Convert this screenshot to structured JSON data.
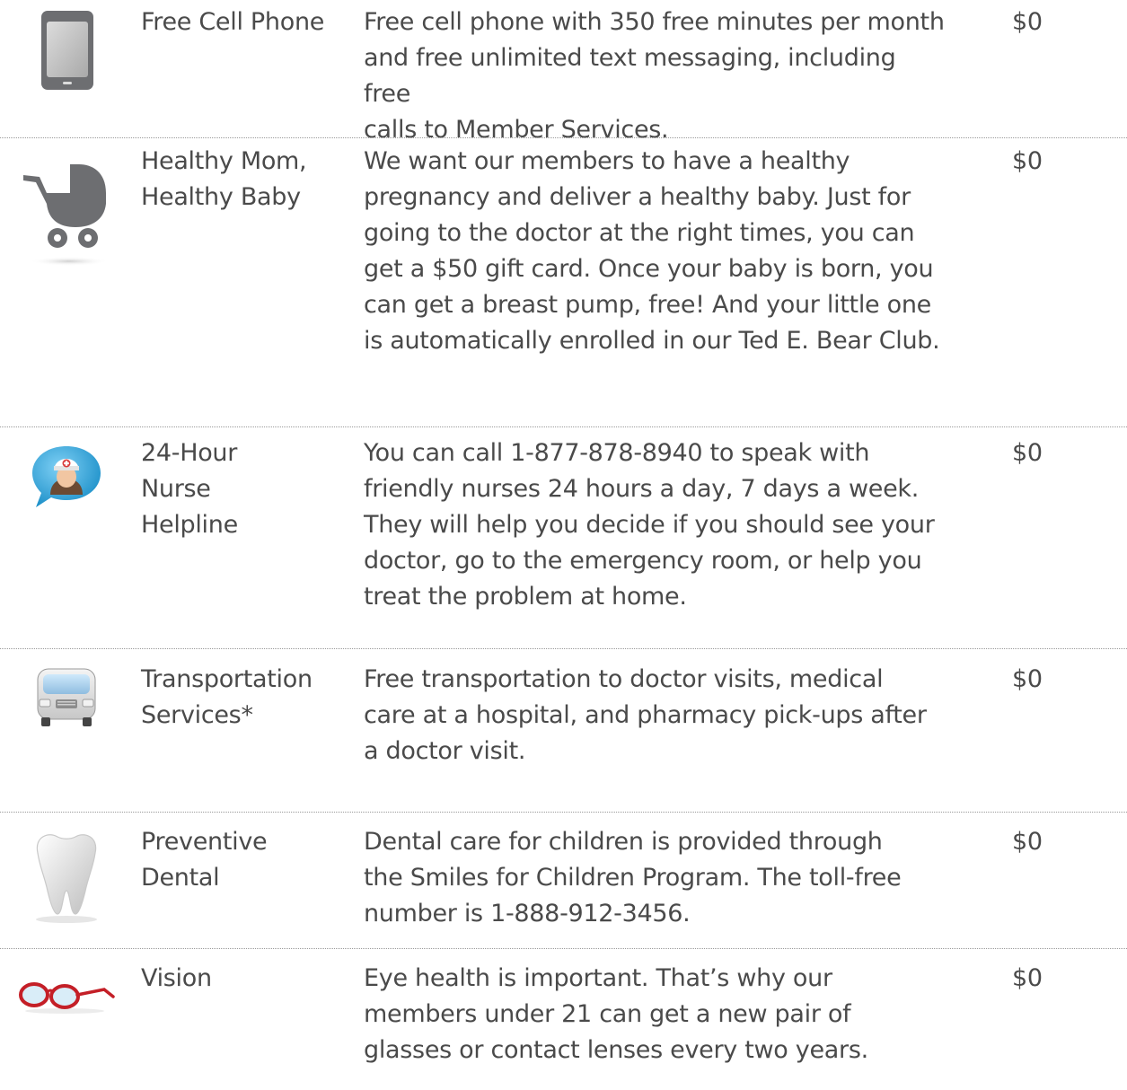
{
  "benefits": [
    {
      "icon": "cell-phone-icon",
      "title": "Free Cell Phone",
      "description": "Free cell phone with 350 free minutes per month\nand free unlimited text messaging, including free\ncalls to Member Services.",
      "price": "$0"
    },
    {
      "icon": "baby-stroller-icon",
      "title": "Healthy Mom,\nHealthy Baby",
      "description": "We want our members to have a healthy\npregnancy and deliver a healthy baby. Just for\ngoing to the doctor at the right times, you can\nget a $50 gift card. Once your baby is born, you\ncan get a breast pump, free! And your little one\nis automatically enrolled in our Ted E. Bear Club.",
      "price": "$0"
    },
    {
      "icon": "nurse-chat-icon",
      "title": "24-Hour\nNurse\nHelpline",
      "description": "You can call 1-877-878-8940 to speak with\nfriendly nurses 24 hours a day, 7 days a week.\nThey will help you decide if you should see your\ndoctor, go to the emergency room, or help you\ntreat the problem at home.",
      "price": "$0"
    },
    {
      "icon": "van-icon",
      "title": "Transportation\nServices*",
      "description": "Free transportation to doctor visits, medical\ncare at a hospital, and pharmacy pick-ups after\na doctor visit.",
      "price": "$0"
    },
    {
      "icon": "tooth-icon",
      "title": "Preventive\nDental",
      "description": "Dental care for children is provided through\nthe Smiles for Children Program. The toll-free\nnumber is 1-888-912-3456.",
      "price": "$0"
    },
    {
      "icon": "eyeglasses-icon",
      "title": "Vision",
      "description": "Eye health is important. That’s why our\nmembers under 21 can get a new pair of\nglasses or contact lenses every two years.",
      "price": "$0"
    }
  ]
}
